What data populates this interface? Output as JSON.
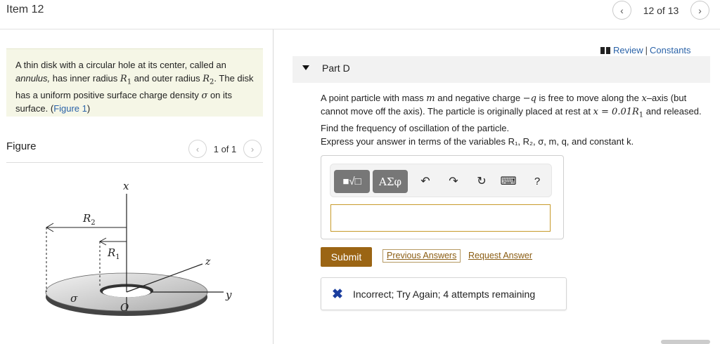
{
  "header": {
    "item_title": "Item 12",
    "pager": "12 of 13"
  },
  "intro": {
    "t1": "A thin disk with a circular hole at its center, called an ",
    "t2": "annulus,",
    "t3": " has inner radius ",
    "R1": "R",
    "R1_sub": "1",
    "t4": " and outer radius ",
    "R2": "R",
    "R2_sub": "2",
    "t5": ". The disk has a uniform positive surface charge density ",
    "sigma": "σ",
    "t6": " on its surface. (",
    "figure_link": "Figure 1",
    "t7": ")"
  },
  "figure": {
    "label": "Figure",
    "pager": "1 of 1",
    "labels": {
      "x_axis": "x",
      "y_axis": "y",
      "z_axis": "z",
      "R2": "R",
      "R2_sub": "2",
      "R1": "R",
      "R1_sub": "1",
      "sigma": "σ",
      "origin": "O"
    }
  },
  "links": {
    "review": "Review",
    "separator": "|",
    "constants": "Constants"
  },
  "part": {
    "title": "Part D",
    "q1": "A point particle with mass ",
    "m": "m",
    "q2": " and negative charge ",
    "negq": "−q",
    "q3": " is free to move along the ",
    "x": "x",
    "q4": "–axis (but cannot move off the axis). The particle is originally placed at rest at ",
    "x_eq": "x = 0.01R",
    "x_eq_sub": "1",
    "q5": " and released. Find the frequency of oscillation of the particle.",
    "express": "Express your answer in terms of the variables R₁, R₂, σ, m, q, and constant k."
  },
  "toolbar": {
    "templates": "■√□",
    "greek": "ΑΣφ",
    "undo": "↶",
    "redo": "↷",
    "reset": "↻",
    "keyboard": "⌨",
    "help": "?"
  },
  "answer": {
    "value": ""
  },
  "actions": {
    "submit": "Submit",
    "previous_answers": "Previous Answers",
    "request_answer": "Request Answer"
  },
  "feedback": {
    "icon": "✖",
    "text": "Incorrect; Try Again; 4 attempts remaining"
  },
  "colors": {
    "link": "#2b63a8",
    "submit_bg": "#9b6514",
    "intro_bg": "#f5f6e6",
    "incorrect_icon": "#1a3d9e"
  }
}
